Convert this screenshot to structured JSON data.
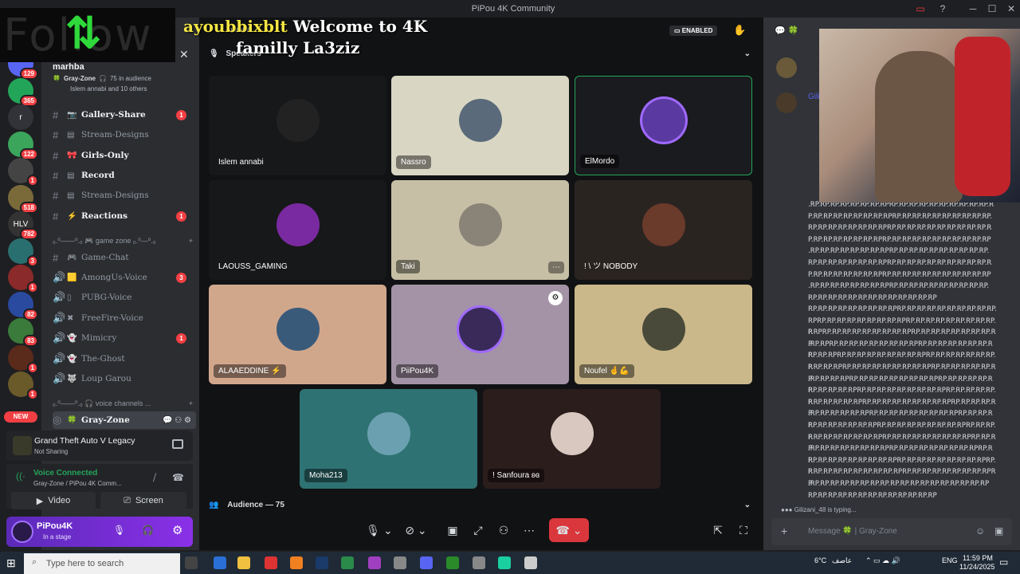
{
  "window": {
    "title": "PiPou 4K Community"
  },
  "overlay": {
    "follow_text": "Follow",
    "line1_user": "ayoubbixblt",
    "line1_rest": "Welcome to 4K",
    "line2": "familly La3ziz"
  },
  "servers": [
    {
      "badge": "129",
      "color": "#5865f2"
    },
    {
      "badge": "365",
      "color": "#23a559"
    },
    {
      "badge": "",
      "label": "r",
      "color": "#313338"
    },
    {
      "badge": "122",
      "color": "#3ba55c"
    },
    {
      "badge": "1",
      "color": "#444"
    },
    {
      "badge": "518",
      "color": "#7a6a3a"
    },
    {
      "badge": "782",
      "label": "HLV",
      "color": "#333"
    },
    {
      "badge": "3",
      "color": "#2a6f6f"
    },
    {
      "badge": "1",
      "color": "#8a2a2a"
    },
    {
      "badge": "82",
      "color": "#2a4aa0"
    },
    {
      "badge": "83",
      "color": "#3a7a3a"
    },
    {
      "badge": "1",
      "color": "#5a2a1a"
    },
    {
      "badge": "1",
      "color": "#6a5a2a"
    }
  ],
  "server_new_label": "NEW",
  "stage_header": {
    "title": "marhba",
    "channel": "Gray-Zone",
    "audience": "75 in audience",
    "members": "Islem annabi and 10 others"
  },
  "channels": [
    {
      "type": "#",
      "emoji": "📷",
      "name": "Gallery-Share",
      "bold": true,
      "badge": "1"
    },
    {
      "type": "#",
      "emoji": "▤",
      "name": "Stream-Designs",
      "bold": false,
      "badge": ""
    },
    {
      "type": "#",
      "emoji": "🎀",
      "name": "Girls-Only",
      "bold": true,
      "badge": ""
    },
    {
      "type": "#",
      "emoji": "▤",
      "name": "Record",
      "bold": true,
      "badge": ""
    },
    {
      "type": "#",
      "emoji": "▤",
      "name": "Stream-Designs",
      "bold": false,
      "badge": ""
    },
    {
      "type": "#",
      "emoji": "⚡",
      "name": "Reactions",
      "bold": true,
      "badge": "1"
    },
    {
      "type": "cat",
      "name": "₀.⁰——⁰.₀ 🎮 game zone ₀.⁰—⁰.₀"
    },
    {
      "type": "#",
      "emoji": "🎮",
      "name": "Game-Chat",
      "bold": false,
      "badge": ""
    },
    {
      "type": "🔊",
      "emoji": "🟨",
      "name": "AmongUs-Voice",
      "bold": false,
      "badge": "3"
    },
    {
      "type": "🔊",
      "emoji": "▯",
      "name": "PUBG-Voice",
      "bold": false,
      "badge": ""
    },
    {
      "type": "🔊",
      "emoji": "✖",
      "name": "FreeFire-Voice",
      "bold": false,
      "badge": ""
    },
    {
      "type": "🔊",
      "emoji": "👻",
      "name": "Mimicry",
      "bold": false,
      "badge": "1"
    },
    {
      "type": "🔊",
      "emoji": "👻",
      "name": "The-Ghost",
      "bold": false,
      "badge": ""
    },
    {
      "type": "🔊",
      "emoji": "🐺",
      "name": "Loup Garou",
      "bold": false,
      "badge": ""
    },
    {
      "type": "cat",
      "name": "₀.⁰——⁰.₀ 🎧 voice channels ..."
    },
    {
      "type": "stage",
      "emoji": "🍀",
      "name": "Gray-Zone",
      "bold": true,
      "badge": ""
    }
  ],
  "activity": {
    "game": "Grand Theft Auto V Legacy",
    "status": "Not Sharing"
  },
  "voice": {
    "status": "Voice Connected",
    "location": "Gray-Zone / PiPou 4K Comm...",
    "video_label": "Video",
    "screen_label": "Screen"
  },
  "user": {
    "name": "PiPou4K",
    "status": "In a stage"
  },
  "stage": {
    "topbar_channel": "marhba",
    "enabled_label": "ENABLED",
    "speakers_label": "Speakers",
    "audience_label": "Audience — 75",
    "tiles": [
      {
        "name": "Islem annabi",
        "bg": "#17181a",
        "av": "#222"
      },
      {
        "name": "Nassro",
        "bg": "#d9d6c3",
        "av": "#5a6a7a",
        "pill": true
      },
      {
        "name": "ElMordo",
        "bg": "#1a1b1e",
        "av": "#5a3aa0",
        "pill": true
      },
      {
        "name": "LAOUSS_GAMING",
        "bg": "#17181a",
        "av": "#7a2aa0"
      },
      {
        "name": "Taki",
        "bg": "#c7bfa5",
        "av": "#8a8478",
        "pill": true
      },
      {
        "name": "! \\ ツ NOBODY",
        "bg": "#2a2421",
        "av": "#6a3a2a"
      },
      {
        "name": "ALAAEDDINE ⚡",
        "bg": "#d1a78c",
        "av": "#3a5a7a",
        "pill": true
      },
      {
        "name": "PiiPou4K",
        "bg": "#a493a7",
        "av": "#3a2a5a",
        "pill": true
      },
      {
        "name": "Noufel 🤞💪",
        "bg": "#cbb88a",
        "av": "#4a4a3a",
        "pill": true
      },
      {
        "name": "Moha213",
        "bg": "#2f7273",
        "av": "#6aa0b0",
        "pill": true
      },
      {
        "name": "! Sanfoura ʚɞ",
        "bg": "#2a1d1c",
        "av": "#d8c8c0",
        "pill": true
      }
    ]
  },
  "chat": {
    "typing": "Gilizani_48 is typing...",
    "placeholder": "Message 🍀 | Gray-Zone",
    "users": [
      "Gilizani_48"
    ],
    "spam_lines": [
      ".RP.RP.RP.RP.RP.RP.RP.RPRP.RP.RP.RP.RP.RP.RP.RP.RP.RP.R",
      "P.RP.RP.RP.RP.RP.RP.RP.RPRP.RP.RP.RP.RP.RP.RP.RP.RP.RP.",
      "RP.RP.RP.RP.RP.RP.RP.RPRP.RP.RP.RP.RP.RP.RP.RP.RP.RP.R",
      "P.RP.RP.RP.RP.RP.RP.RPRP.RP.RP.RP.RP.RP.RP.RP.RP.RP.RP",
      ".RP.RP.RP.RP.RP.RP.RP.RPRP.RP.RP.RP.RP.RP.RP.RP.RP.RP.",
      "RP.RP.RP.RP.RP.RP.RP.RPRP.RP.RP.RP.RP.RP.RP.RP.RP.RP.R",
      "P.RP.RP.RP.RP.RP.RP.RPRP.RP.RP.RP.RP.RP.RP.RP.RP.RP.RP",
      ".RP.RP.RP.RP.RP.RP.RP.RPRP.RP.RP.RP.RP.RP.RP.RP.RP.RP.",
      "RP.RP.RP.RP.RP.RP.RP.RP.RP.RP.RP.RP.RP"
    ],
    "spam_lines2": [
      "RP.RP.RP.RP.RP.RP.RP.RP.RPRP.RP.RP.RP.RP.RP.RP.RP.RP.RP.",
      "RPRP.RP.RP.RP.RP.RP.RP.RP.RPRP.RP.RP.RP.RP.RP.RP.RP.RP.R",
      "P.RPRP.RP.RP.RP.RP.RP.RP.RP.RPRP.RP.RP.RP.RP.RP.RP.RP.RP",
      ".RP.RPRP.RP.RP.RP.RP.RP.RP.RP.RPRP.RP.RP.RP.RP.RP.RP.RP.",
      "RP.RP.RPRP.RP.RP.RP.RP.RP.RP.RP.RPRP.RP.RP.RP.RP.RP.RP.R",
      "P.RP.RP.RPRP.RP.RP.RP.RP.RP.RP.RP.RPRP.RP.RP.RP.RP.RP.RP",
      ".RP.RP.RP.RPRP.RP.RP.RP.RP.RP.RP.RP.RPRP.RP.RP.RP.RP.RP.",
      "RP.RP.RP.RP.RPRP.RP.RP.RP.RP.RP.RP.RP.RPRP.RP.RP.RP.RP.R",
      "P.RP.RP.RP.RP.RPRP.RP.RP.RP.RP.RP.RP.RP.RPRP.RP.RP.RP.RP",
      ".RP.RP.RP.RP.RP.RPRP.RP.RP.RP.RP.RP.RP.RP.RPRP.RP.RP.RP.",
      "RP.RP.RP.RP.RP.RP.RPRP.RP.RP.RP.RP.RP.RP.RP.RPRP.RP.RP.R",
      "P.RP.RP.RP.RP.RP.RP.RPRP.RP.RP.RP.RP.RP.RP.RP.RPRP.RP.RP",
      ".RP.RP.RP.RP.RP.RP.RP.RPRP.RP.RP.RP.RP.RP.RP.RP.RPRP.RP.",
      "RP.RP.RP.RP.RP.RP.RP.RP.RPRP.RP.RP.RP.RP.RP.RP.RP.RPRP.R",
      "P.RP.RP.RP.RP.RP.RP.RP.RP.RPRP.RP.RP.RP.RP.RP.RP.RP.RPRP",
      ".RP.RP.RP.RP.RP.RP.RP.RP.RP.RP.RP.RP.RP.RP.RP.RP.RP.RP",
      "RP.RP.RP.RP.RP.RP.RP.RP.RP.RP.RP.RP.RP"
    ]
  },
  "taskbar": {
    "search_placeholder": "Type here to search",
    "weather": "6°C",
    "weather_label": "عاصف",
    "lang": "ENG",
    "time": "11:59 PM",
    "date": "11/24/2025"
  }
}
